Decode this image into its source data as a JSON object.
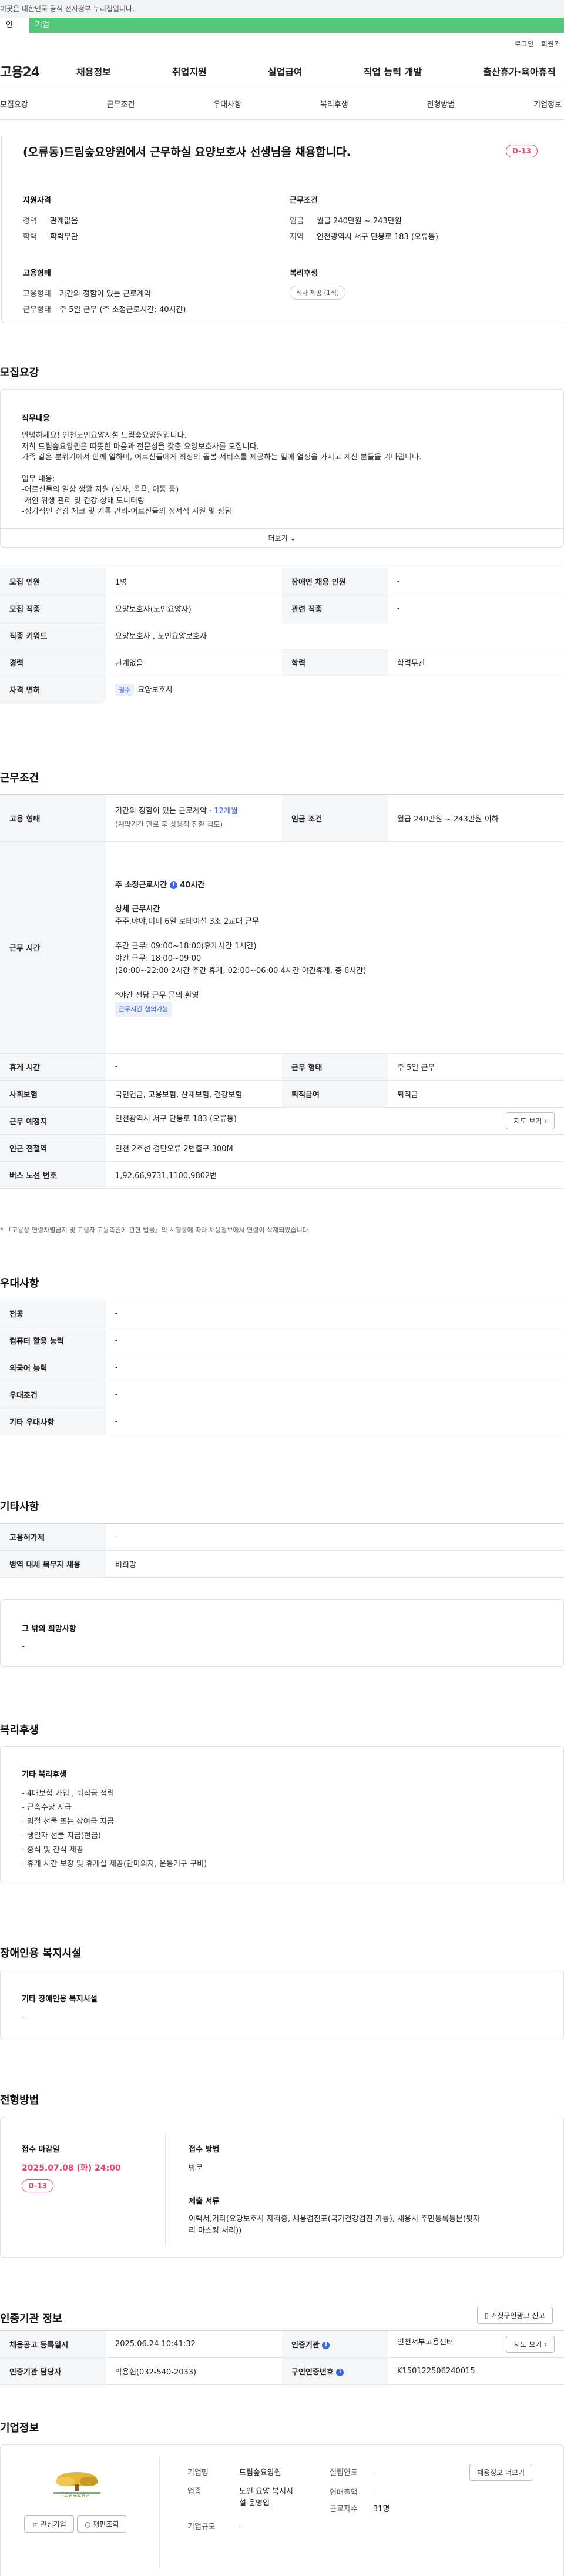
{
  "gov_bar": "이곳은 대한민국 공식 전자정부 누리집입니다.",
  "tabs": [
    "인",
    "기업"
  ],
  "util": [
    "로그인",
    "회원가"
  ],
  "logo": "고용24",
  "gnb": [
    "채용정보",
    "취업지원",
    "실업급여",
    "직업 능력 개발",
    "출산휴가·육아휴직"
  ],
  "subnav": [
    "모집요강",
    "근무조건",
    "우대사항",
    "복리후생",
    "전형방법",
    "기업정보"
  ],
  "summary": {
    "title": "(오류동)드림숲요양원에서 근무하실 요양보호사 선생님을 채용합니다.",
    "dday": "D-13",
    "qual_h": "지원자격",
    "career_k": "경력",
    "career_v": "관계없음",
    "edu_k": "학력",
    "edu_v": "학력무관",
    "cond_h": "근무조건",
    "wage_k": "임금",
    "wage_v": "월급 240만원 ~ 243만원",
    "area_k": "지역",
    "area_v": "인천광역시 서구 단봉로 183 (오류동)",
    "emp_h": "고용형태",
    "type_k": "고용형태",
    "type_v": "기간의 정함이 있는 근로계약",
    "hours_k": "근무형태",
    "hours_v": "주 5일 근무 (주 소정근로시간: 40시간)",
    "welfare_h": "복리후생",
    "welfare_badge": "식사 제공 (1식)"
  },
  "recruit": {
    "heading": "모집요강",
    "duty_h": "직무내용",
    "duty_lines": [
      "안녕하세요! 인천노인요양시설 드림숲요양원입니다.",
      "저희 드림숲요양원은 따뜻한 마음과 전문성을 갖춘 요양보호사를 모집니다.",
      "가족 같은 분위기에서 함께 일하며, 어르신들에게 최상의 돌봄 서비스를 제공하는 일에 열정을 가지고 계신 분들을 기다립니다.",
      "",
      "업무 내용:",
      "-어르신들의 일상 생활 지원 (식사, 목욕, 이동 등)",
      "-개인 위생 관리 및 건강 상태 모니터링",
      "-정기적인 건강 체크 및 기록 관리-어르신들의 정서적 지원 및 상담"
    ],
    "more": "더보기",
    "rows": [
      {
        "k1": "모집 인원",
        "v1": "1명",
        "k2": "장애인 채용 인원",
        "v2": "-"
      },
      {
        "k1": "모집 직종",
        "v1": "요양보호사(노인요양사)",
        "k2": "관련 직종",
        "v2": "-"
      },
      {
        "k1": "직종 키워드",
        "v1": "요양보호사 , 노인요양보호사"
      },
      {
        "k1": "경력",
        "v1": "관계없음",
        "k2": "학력",
        "v2": "학력무관"
      },
      {
        "k1": "자격 면허",
        "chip": "필수",
        "v1": "요양보호사"
      }
    ]
  },
  "work": {
    "heading": "근무조건",
    "type_k": "고용 형태",
    "type_v1": "기간의 정함이 있는 근로계약 · ",
    "type_months": "12개월",
    "type_v2": "(계약기간 만료 후 상용직 전환 검토)",
    "wage_k": "임금 조건",
    "wage_v": "월급 240만원 ~ 243만원 이하",
    "time_k": "근무 시간",
    "time_h": "주 소정근로시간",
    "time_h2": "40시간",
    "detail_h": "상세 근무시간",
    "detail_lines": [
      "주주,야야,비비 6일 로테이션 3조 2교대 근무",
      "",
      "주간 근무: 09:00~18:00(휴게시간 1시간)",
      "야간 근무: 18:00~09:00",
      "(20:00~22:00 2시간 주간 휴게, 02:00~06:00 4시간 야간휴게, 총 6시간)",
      "",
      "*야간 전담 근무 문의 환영"
    ],
    "time_chip": "근무시간 협의가능",
    "rows": [
      {
        "k1": "휴게 시간",
        "v1": "-",
        "k2": "근무 형태",
        "v2": "주 5일 근무"
      },
      {
        "k1": "사회보험",
        "v1": "국민연금, 고용보험, 산재보험, 건강보험",
        "k2": "퇴직급여",
        "v2": "퇴직금"
      },
      {
        "k1": "근무 예정지",
        "v1": "인천광역시 서구 단봉로 183 (오류동)",
        "btn": "지도 보기"
      },
      {
        "k1": "인근 전철역",
        "v1": "인천 2호선 검단오류 2번출구 300M"
      },
      {
        "k1": "버스 노선 번호",
        "v1": "1,92,66,9731,1100,9802번"
      }
    ],
    "note": "* 「고용상 연령차별금지 및 고령자 고용촉진에 관한 법률」의 시행령에 따라 채용정보에서 연령이 삭제되었습니다."
  },
  "pref": {
    "heading": "우대사항",
    "rows": [
      {
        "k": "전공",
        "v": "-"
      },
      {
        "k": "컴퓨터 활용 능력",
        "v": "-"
      },
      {
        "k": "외국어 능력",
        "v": "-"
      },
      {
        "k": "우대조건",
        "v": "-"
      },
      {
        "k": "기타 우대사항",
        "v": "-"
      }
    ]
  },
  "etc": {
    "heading": "기타사항",
    "rows": [
      {
        "k": "고용허가제",
        "v": "-"
      },
      {
        "k": "병역 대체 복무자 채용",
        "v": "비희망"
      }
    ],
    "other_h": "그 밖의 희망사항",
    "other_v": "-"
  },
  "welfare": {
    "heading": "복리후생",
    "box_h": "기타 복리후생",
    "lines": [
      "- 4대보험 가입 , 퇴직금 적립",
      "- 근속수당 지급",
      "- 명절 선물 또는 상여금 지급",
      "- 생일자 선물 지급(현금)",
      "- 중식 및 간식 제공",
      "- 휴게 시간 보장 및 휴게실 제공(안마의자, 운동기구 구비)"
    ]
  },
  "disabled": {
    "heading": "장애인용 복지시설",
    "box_h": "기타 장애인용 복지시설",
    "box_v": "-"
  },
  "process": {
    "heading": "전형방법",
    "deadline_h": "접수 마감일",
    "deadline_v": "2025.07.08 (화) 24:00",
    "dday": "D-13",
    "method_h": "접수 방법",
    "method_v": "방문",
    "docs_h": "제출 서류",
    "docs_v1": "이력서,기타(요양보호사 자격증, 채용검진표(국가건강검진 가능), 채용시 주민등록등본(뒷자",
    "docs_v2": "리 마스킹 처리))"
  },
  "agency": {
    "heading": "인증기관 정보",
    "report_btn": "거짓구인광고 신고",
    "rows": [
      {
        "k1": "채용공고 등록일시",
        "v1": "2025.06.24 10:41:32",
        "k2": "인증기관",
        "v2": "인천서부고용센터",
        "btn": "지도 보기"
      },
      {
        "k1": "인증기관 담당자",
        "v1": "박용현(032-540-2033)",
        "k2": "구인인증번호",
        "v2": "K150122506240015"
      }
    ]
  },
  "company": {
    "heading": "기업정보",
    "logo_text": "드림숲요양원",
    "fav_btn": "관심기업",
    "review_btn": "평판조회",
    "name_k": "기업명",
    "name_v": "드림숲요양원",
    "year_k": "설립연도",
    "year_v": "-",
    "ind_k": "업종",
    "ind_v1": "노인 요양 복지시",
    "ind_v2": "설 운영업",
    "sales_k": "연매출액",
    "sales_v": "-",
    "staff_k": "근로자수",
    "staff_v": "31명",
    "size_k": "기업규모",
    "size_v": "-",
    "more_btn": "채용정보 더보기"
  }
}
